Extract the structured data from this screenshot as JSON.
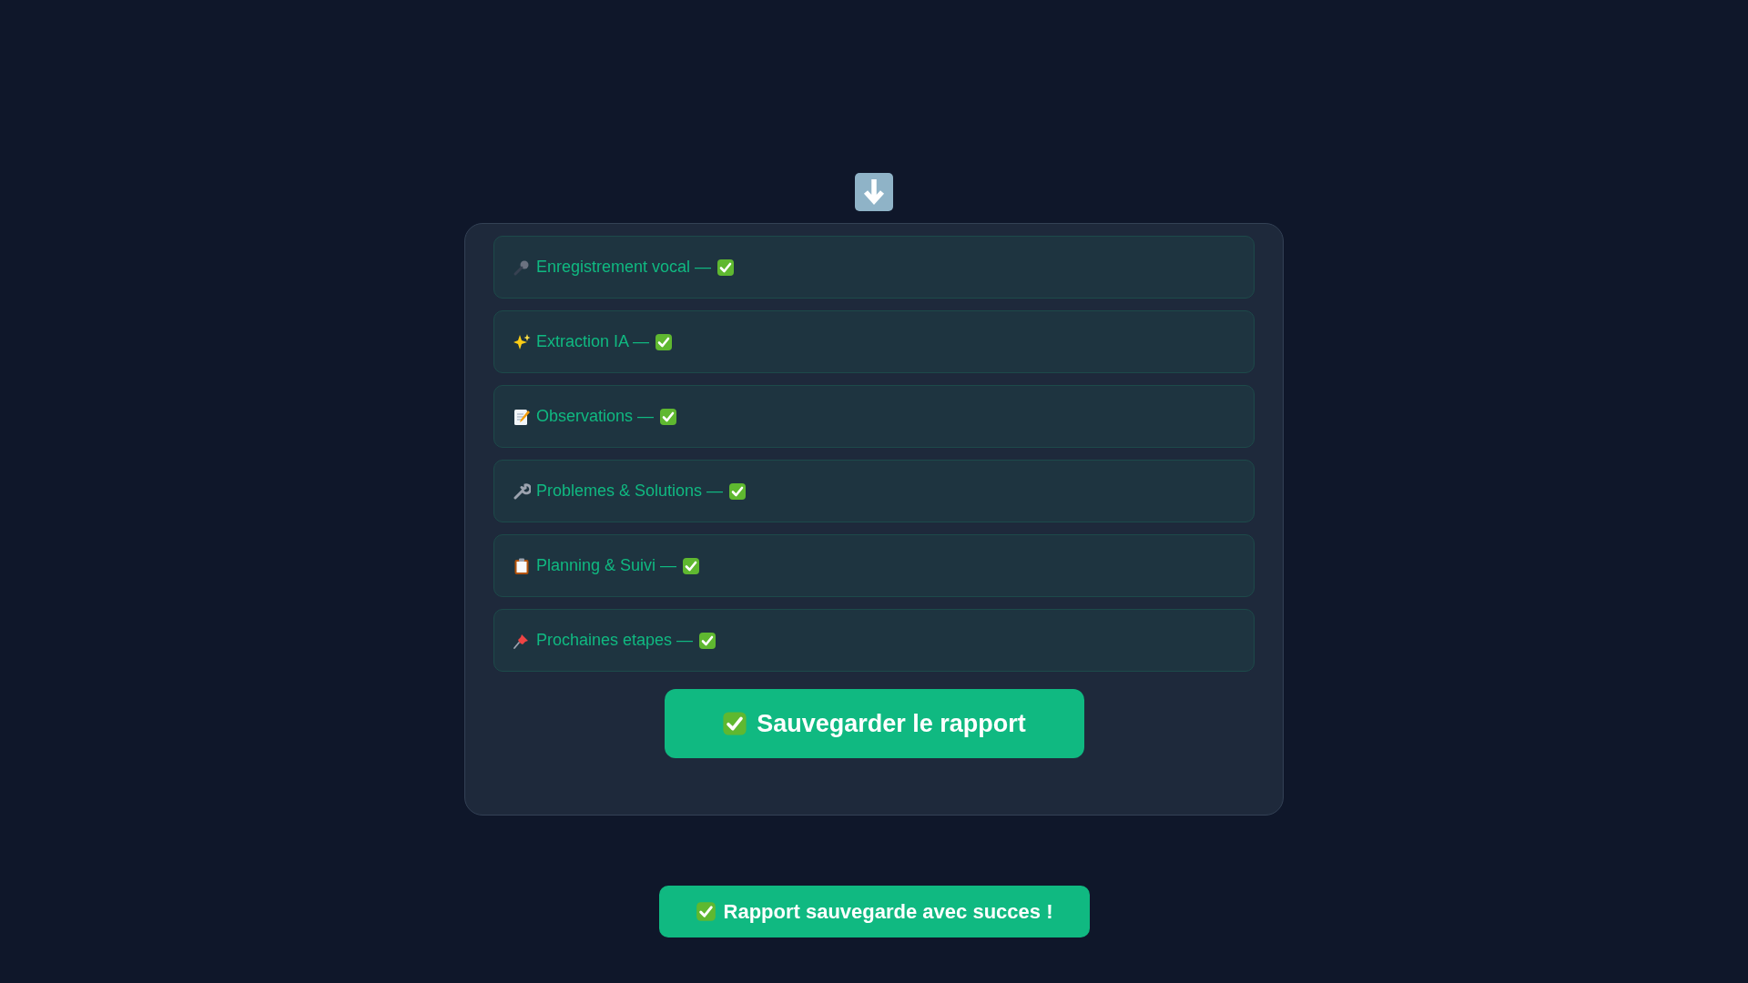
{
  "steps": [
    {
      "label": "Enregistrement vocal —",
      "done": true
    },
    {
      "label": "Extraction IA —",
      "done": true
    },
    {
      "label": "Observations —",
      "done": true
    },
    {
      "label": "Problemes & Solutions —",
      "done": true
    },
    {
      "label": "Planning & Suivi —",
      "done": true
    },
    {
      "label": "Prochaines etapes —",
      "done": true
    }
  ],
  "save_button": {
    "label": "Sauvegarder le rapport"
  },
  "toast": {
    "message": "Rapport sauvegarde avec succes !"
  }
}
